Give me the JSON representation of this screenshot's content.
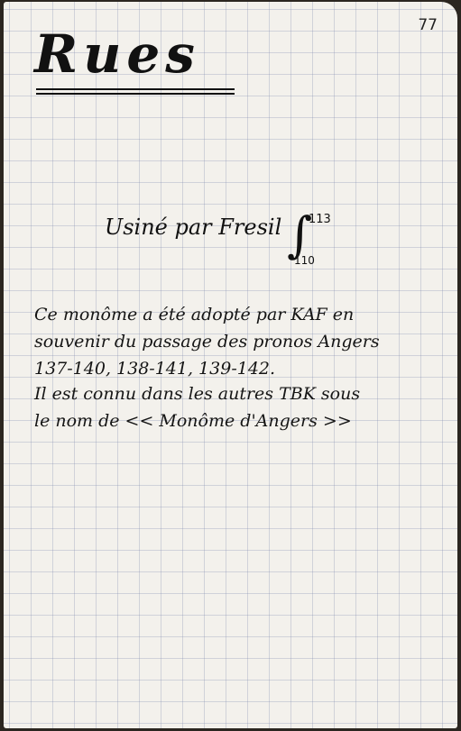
{
  "page_number": "77",
  "title": "Rues",
  "subtitle": "Usiné par Fresil",
  "integral": {
    "upper": "113",
    "lower": "110"
  },
  "body_lines": [
    "Ce monôme a été adopté par KAF en",
    "souvenir du passage des pronos Angers",
    "137-140, 138-141, 139-142.",
    "Il est connu dans les autres TBK sous",
    "le nom de << Monôme d'Angers >>"
  ]
}
